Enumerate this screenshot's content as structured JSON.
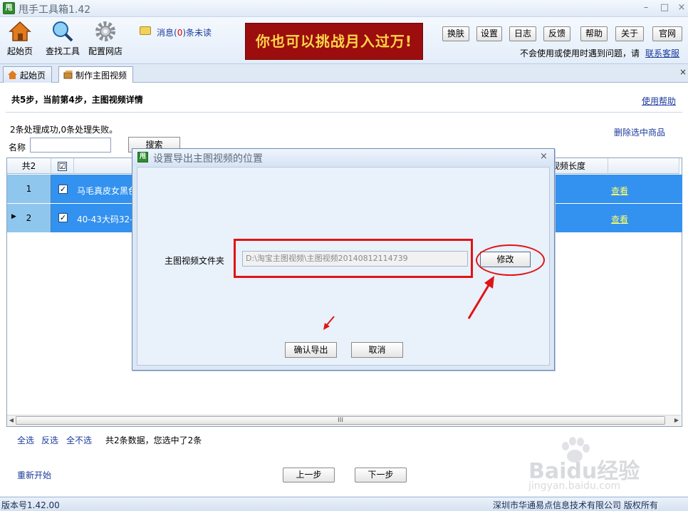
{
  "window": {
    "title": "甩手工具箱1.42",
    "logo_text": "甩",
    "minimize": "–",
    "maximize": "□",
    "close": "×"
  },
  "toolbar": {
    "tools": [
      {
        "label": "起始页",
        "icon": "home-icon"
      },
      {
        "label": "查找工具",
        "icon": "magnifier-icon"
      },
      {
        "label": "配置网店",
        "icon": "gear-icon"
      }
    ],
    "messages": {
      "prefix": "消息(",
      "count": "0",
      "suffix": ")条未读"
    },
    "banner": "你也可以挑战月入过万!",
    "buttons": [
      "换肤",
      "设置",
      "日志",
      "反馈",
      "帮助",
      "关于",
      "官网"
    ],
    "help_text": "不会使用或使用时遇到问题，请",
    "contact_link": "联系客服"
  },
  "tabs": [
    {
      "label": "起始页",
      "icon": "home-icon"
    },
    {
      "label": "制作主图视频",
      "icon": "box-icon",
      "active": true
    }
  ],
  "tabs_close": "×",
  "page": {
    "step_title": "共5步，当前第4步，主图视频详情",
    "usage_help": "使用帮助",
    "result_text": "2条处理成功,0条处理失败。",
    "delete_selected": "删除选中商品",
    "name_label": "名称",
    "name_value": "",
    "search_button": "搜索"
  },
  "grid": {
    "headers": {
      "count": "共2",
      "checkbox": "☑",
      "length": "视频长度"
    },
    "rows": [
      {
        "index": "1",
        "checked": "✓",
        "title": "马毛真皮女黑色",
        "link": "查看"
      },
      {
        "index": "2",
        "checked": "✓",
        "title": "40-43大码32-3",
        "link": "查看"
      }
    ],
    "scroll_grip": "III"
  },
  "footer": {
    "select_all": "全选",
    "invert": "反选",
    "select_none": "全不选",
    "count_text": "共2条数据，您选中了2条",
    "restart": "重新开始",
    "prev": "上一步",
    "next": "下一步"
  },
  "status": {
    "version": "版本号1.42.00",
    "copyright": "深圳市华通易点信息技术有限公司 版权所有"
  },
  "dialog": {
    "logo_text": "甩",
    "title": "设置导出主图视频的位置",
    "close": "×",
    "folder_label": "主图视频文件夹",
    "folder_path": "D:\\淘宝主图视频\\主图视频20140812114739",
    "modify_button": "修改",
    "confirm_button": "确认导出",
    "cancel_button": "取消"
  },
  "watermark": {
    "brand": "Baidu经验",
    "url": "jingyan.baidu.com"
  },
  "colors": {
    "accent": "#1b3a9b",
    "annotation": "#e01414",
    "row_selected": "#3391ef",
    "banner_bg": "#9c0d0d",
    "banner_text": "#ffd54a"
  }
}
